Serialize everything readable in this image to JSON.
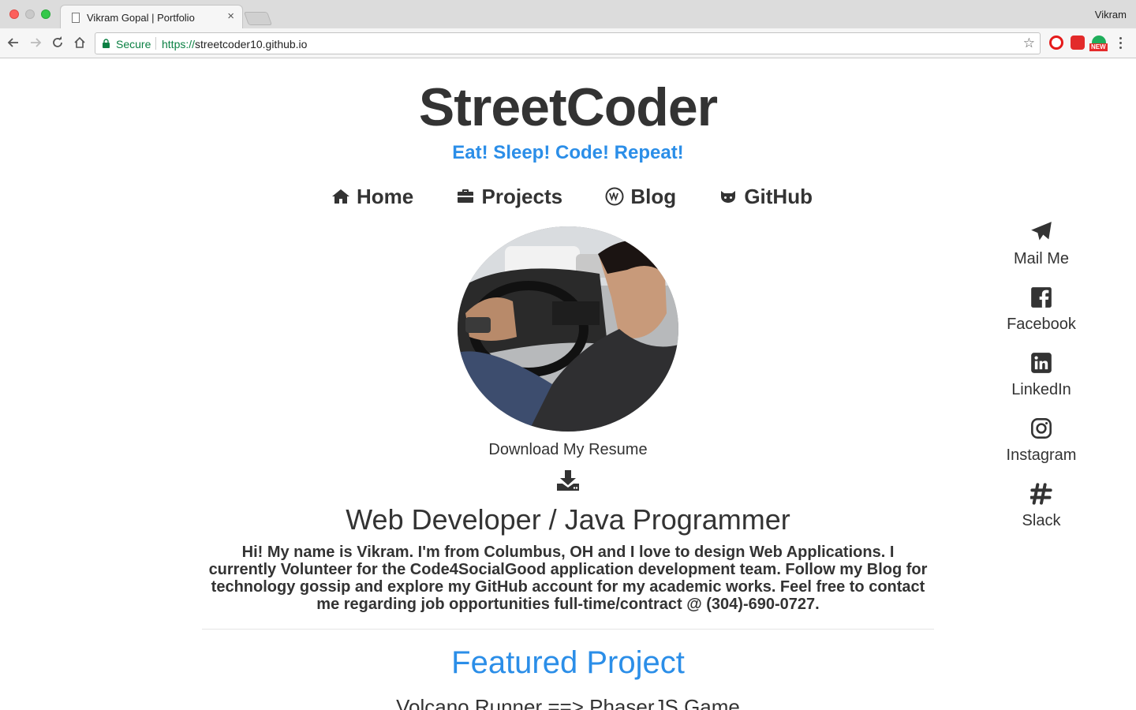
{
  "browser": {
    "tab_title": "Vikram Gopal | Portfolio",
    "tab_close": "×",
    "profile_name": "Vikram",
    "secure_label": "Secure",
    "url_scheme": "https://",
    "url_host": "streetcoder10.github.io",
    "bookmark_star": "☆",
    "extension_badge": "NEW"
  },
  "header": {
    "title": "StreetCoder",
    "tagline": "Eat! Sleep! Code! Repeat!"
  },
  "nav": [
    {
      "label": "Home",
      "icon": "home-icon"
    },
    {
      "label": "Projects",
      "icon": "briefcase-icon"
    },
    {
      "label": "Blog",
      "icon": "wordpress-icon"
    },
    {
      "label": "GitHub",
      "icon": "github-icon"
    }
  ],
  "profile": {
    "resume_label": "Download My Resume",
    "role": "Web Developer / Java Programmer",
    "bio": "Hi! My name is Vikram. I'm from Columbus, OH and I love to design Web Applications. I currently Volunteer for the Code4SocialGood application development team. Follow my Blog for technology gossip and explore my GitHub account for my academic works. Feel free to contact me regarding job opportunities full-time/contract @ (304)-690-0727."
  },
  "featured": {
    "heading": "Featured Project",
    "project_title": "Volcano Runner ==> PhaserJS Game"
  },
  "social": [
    {
      "label": "Mail Me",
      "icon": "paper-plane-icon"
    },
    {
      "label": "Facebook",
      "icon": "facebook-icon"
    },
    {
      "label": "LinkedIn",
      "icon": "linkedin-icon"
    },
    {
      "label": "Instagram",
      "icon": "instagram-icon"
    },
    {
      "label": "Slack",
      "icon": "slack-icon"
    }
  ],
  "colors": {
    "accent": "#2b8ee8",
    "text": "#333333",
    "secure_green": "#0b8043"
  }
}
